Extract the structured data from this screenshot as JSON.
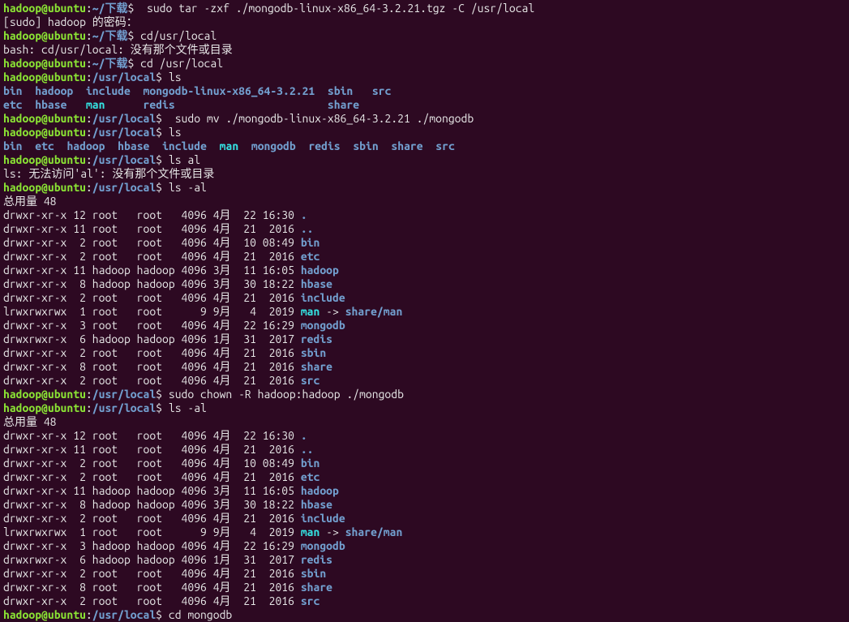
{
  "user": "hadoop",
  "host": "ubuntu",
  "paths": {
    "dl": "~/下载",
    "ul": "/usr/local"
  },
  "cmds": {
    "c1": " sudo tar -zxf ./mongodb-linux-x86_64-3.2.21.tgz -C /usr/local",
    "sudo_pw": "[sudo] hadoop 的密码：",
    "c2": "cd/usr/local",
    "err_cd": "bash: cd/usr/local: 没有那个文件或目录",
    "c3": "cd /usr/local",
    "c4": "ls",
    "c5": " sudo mv ./mongodb-linux-x86_64-3.2.21 ./mongodb",
    "c6": "ls",
    "c7": "ls al",
    "err_ls": "ls: 无法访问'al': 没有那个文件或目录",
    "c8": "ls -al",
    "c9": "sudo chown -R hadoop:hadoop ./mongodb",
    "c10": "ls -al",
    "c11": "cd mongodb"
  },
  "ls1": {
    "r1": {
      "a": "bin",
      "b": "hadoop",
      "c": "include",
      "d": "mongodb-linux-x86_64-3.2.21",
      "e": "sbin",
      "f": "src"
    },
    "r2": {
      "a": "etc",
      "b": "hbase",
      "c": "man",
      "d": "redis",
      "e": "share"
    }
  },
  "ls2": {
    "items": [
      "bin",
      "etc",
      "hadoop",
      "hbase",
      "include",
      "man",
      "mongodb",
      "redis",
      "sbin",
      "share",
      "src"
    ]
  },
  "total": "总用量 48",
  "listing1": [
    {
      "perm": "drwxr-xr-x 12 root   root   4096 4月  22 16:30 ",
      "name": ".",
      "cls": "d"
    },
    {
      "perm": "drwxr-xr-x 11 root   root   4096 4月  21  2016 ",
      "name": "..",
      "cls": "d"
    },
    {
      "perm": "drwxr-xr-x  2 root   root   4096 4月  10 08:49 ",
      "name": "bin",
      "cls": "d"
    },
    {
      "perm": "drwxr-xr-x  2 root   root   4096 4月  21  2016 ",
      "name": "etc",
      "cls": "d"
    },
    {
      "perm": "drwxr-xr-x 11 hadoop hadoop 4096 3月  11 16:05 ",
      "name": "hadoop",
      "cls": "d"
    },
    {
      "perm": "drwxr-xr-x  8 hadoop hadoop 4096 3月  30 18:22 ",
      "name": "hbase",
      "cls": "d"
    },
    {
      "perm": "drwxr-xr-x  2 root   root   4096 4月  21  2016 ",
      "name": "include",
      "cls": "d"
    },
    {
      "perm": "lrwxrwxrwx  1 root   root      9 9月   4  2019 ",
      "name": "man",
      "cls": "l",
      "suffix": " -> ",
      "target": "share/man"
    },
    {
      "perm": "drwxr-xr-x  3 root   root   4096 4月  22 16:29 ",
      "name": "mongodb",
      "cls": "d"
    },
    {
      "perm": "drwxrwxr-x  6 hadoop hadoop 4096 1月  31  2017 ",
      "name": "redis",
      "cls": "d"
    },
    {
      "perm": "drwxr-xr-x  2 root   root   4096 4月  21  2016 ",
      "name": "sbin",
      "cls": "d"
    },
    {
      "perm": "drwxr-xr-x  8 root   root   4096 4月  21  2016 ",
      "name": "share",
      "cls": "d"
    },
    {
      "perm": "drwxr-xr-x  2 root   root   4096 4月  21  2016 ",
      "name": "src",
      "cls": "d"
    }
  ],
  "listing2": [
    {
      "perm": "drwxr-xr-x 12 root   root   4096 4月  22 16:30 ",
      "name": ".",
      "cls": "d"
    },
    {
      "perm": "drwxr-xr-x 11 root   root   4096 4月  21  2016 ",
      "name": "..",
      "cls": "d"
    },
    {
      "perm": "drwxr-xr-x  2 root   root   4096 4月  10 08:49 ",
      "name": "bin",
      "cls": "d"
    },
    {
      "perm": "drwxr-xr-x  2 root   root   4096 4月  21  2016 ",
      "name": "etc",
      "cls": "d"
    },
    {
      "perm": "drwxr-xr-x 11 hadoop hadoop 4096 3月  11 16:05 ",
      "name": "hadoop",
      "cls": "d"
    },
    {
      "perm": "drwxr-xr-x  8 hadoop hadoop 4096 3月  30 18:22 ",
      "name": "hbase",
      "cls": "d"
    },
    {
      "perm": "drwxr-xr-x  2 root   root   4096 4月  21  2016 ",
      "name": "include",
      "cls": "d"
    },
    {
      "perm": "lrwxrwxrwx  1 root   root      9 9月   4  2019 ",
      "name": "man",
      "cls": "l",
      "suffix": " -> ",
      "target": "share/man"
    },
    {
      "perm": "drwxr-xr-x  3 hadoop hadoop 4096 4月  22 16:29 ",
      "name": "mongodb",
      "cls": "d"
    },
    {
      "perm": "drwxrwxr-x  6 hadoop hadoop 4096 1月  31  2017 ",
      "name": "redis",
      "cls": "d"
    },
    {
      "perm": "drwxr-xr-x  2 root   root   4096 4月  21  2016 ",
      "name": "sbin",
      "cls": "d"
    },
    {
      "perm": "drwxr-xr-x  8 root   root   4096 4月  21  2016 ",
      "name": "share",
      "cls": "d"
    },
    {
      "perm": "drwxr-xr-x  2 root   root   4096 4月  21  2016 ",
      "name": "src",
      "cls": "d"
    }
  ]
}
